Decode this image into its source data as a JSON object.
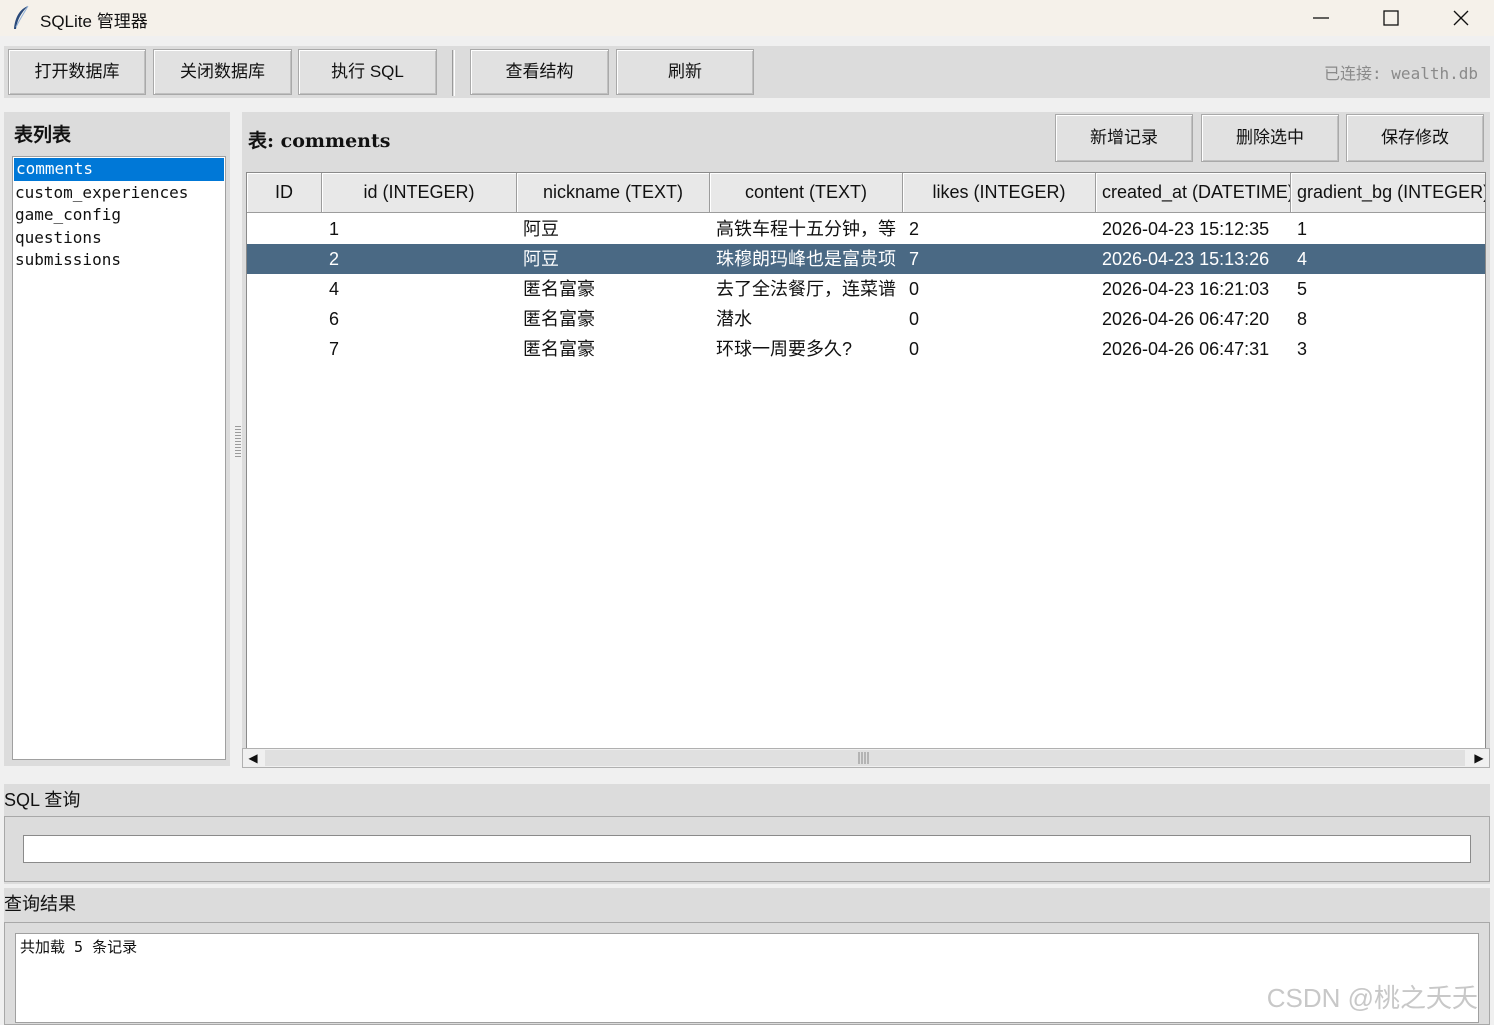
{
  "window": {
    "title": "SQLite 管理器"
  },
  "toolbar": {
    "open_db": "打开数据库",
    "close_db": "关闭数据库",
    "exec_sql": "执行 SQL",
    "view_schema": "查看结构",
    "refresh": "刷新",
    "connection": "已连接: wealth.db"
  },
  "sidebar": {
    "title": "表列表",
    "tables": [
      "comments",
      "custom_experiences",
      "game_config",
      "questions",
      "submissions"
    ],
    "selected": "comments"
  },
  "main": {
    "table_label": "表: comments",
    "add_record": "新增记录",
    "delete_selected": "删除选中",
    "save_changes": "保存修改",
    "columns": [
      "ID",
      "id (INTEGER)",
      "nickname (TEXT)",
      "content (TEXT)",
      "likes (INTEGER)",
      "created_at (DATETIME)",
      "gradient_bg (INTEGER)"
    ],
    "rows": [
      [
        "",
        "1",
        "阿豆",
        "高铁车程十五分钟，等",
        "2",
        "2026-04-23 15:12:35",
        "1"
      ],
      [
        "",
        "2",
        "阿豆",
        "珠穆朗玛峰也是富贵项",
        "7",
        "2026-04-23 15:13:26",
        "4"
      ],
      [
        "",
        "4",
        "匿名富豪",
        "去了全法餐厅，连菜谱",
        "0",
        "2026-04-23 16:21:03",
        "5"
      ],
      [
        "",
        "6",
        "匿名富豪",
        "潜水",
        "0",
        "2026-04-26 06:47:20",
        "8"
      ],
      [
        "",
        "7",
        "匿名富豪",
        "环球一周要多久?",
        "0",
        "2026-04-26 06:47:31",
        "3"
      ]
    ],
    "selected_row": 1
  },
  "sql": {
    "title": "SQL 查询",
    "value": ""
  },
  "results": {
    "title": "查询结果",
    "text": "共加载 5 条记录"
  },
  "watermark": "CSDN @桃之夭夭"
}
